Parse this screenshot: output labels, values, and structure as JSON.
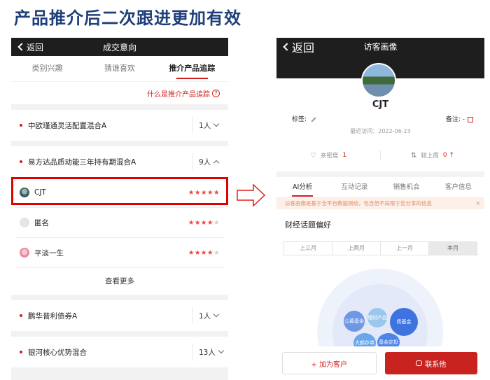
{
  "slide": {
    "title": "产品推介后二次跟进更加有效"
  },
  "left": {
    "nav": {
      "back": "返回",
      "title": "成交意向"
    },
    "tabs": [
      "类别兴趣",
      "猜谁喜欢",
      "推介产品追踪"
    ],
    "help": "什么是推介产品追踪",
    "products": [
      {
        "name": "中欧瑾通灵活配置混合A",
        "count": "1人"
      },
      {
        "name": "易方达品质动能三年持有期混合A",
        "count": "9人"
      },
      {
        "name": "鹏华普利债券A",
        "count": "1人"
      },
      {
        "name": "银河核心优势混合",
        "count": "13人"
      }
    ],
    "users": [
      {
        "name": "CJT",
        "stars": "★★★★★",
        "off": ""
      },
      {
        "name": "匿名",
        "stars": "★★★★",
        "off": "★"
      },
      {
        "name": "平淡一生",
        "stars": "★★★★",
        "off": "★"
      }
    ],
    "see_more": "查看更多"
  },
  "right": {
    "nav": {
      "back": "返回",
      "title": "访客画像"
    },
    "name": "CJT",
    "tag_label": "标签:",
    "note_label": "备注: -",
    "visit": "最近访问：2022-06-23",
    "stat1": {
      "label": "亲密度",
      "value": "1"
    },
    "stat2": {
      "label": "较上周",
      "value": "0 ↑"
    },
    "tabs": [
      "AI分析",
      "互动记录",
      "销售机会",
      "客户信息"
    ],
    "notice": "访客画像是基于全平台数据测绘，包含但不局限于您分享的信息",
    "notice_close": "×",
    "section_title": "财经话题偏好",
    "periods": [
      "上三月",
      "上两月",
      "上一月",
      "本月"
    ],
    "bubbles": [
      "公募基金",
      "理财产品",
      "债基金",
      "大额存单",
      "基金定投"
    ],
    "add_button": "+ 加为客户",
    "contact_button": "联系他"
  }
}
